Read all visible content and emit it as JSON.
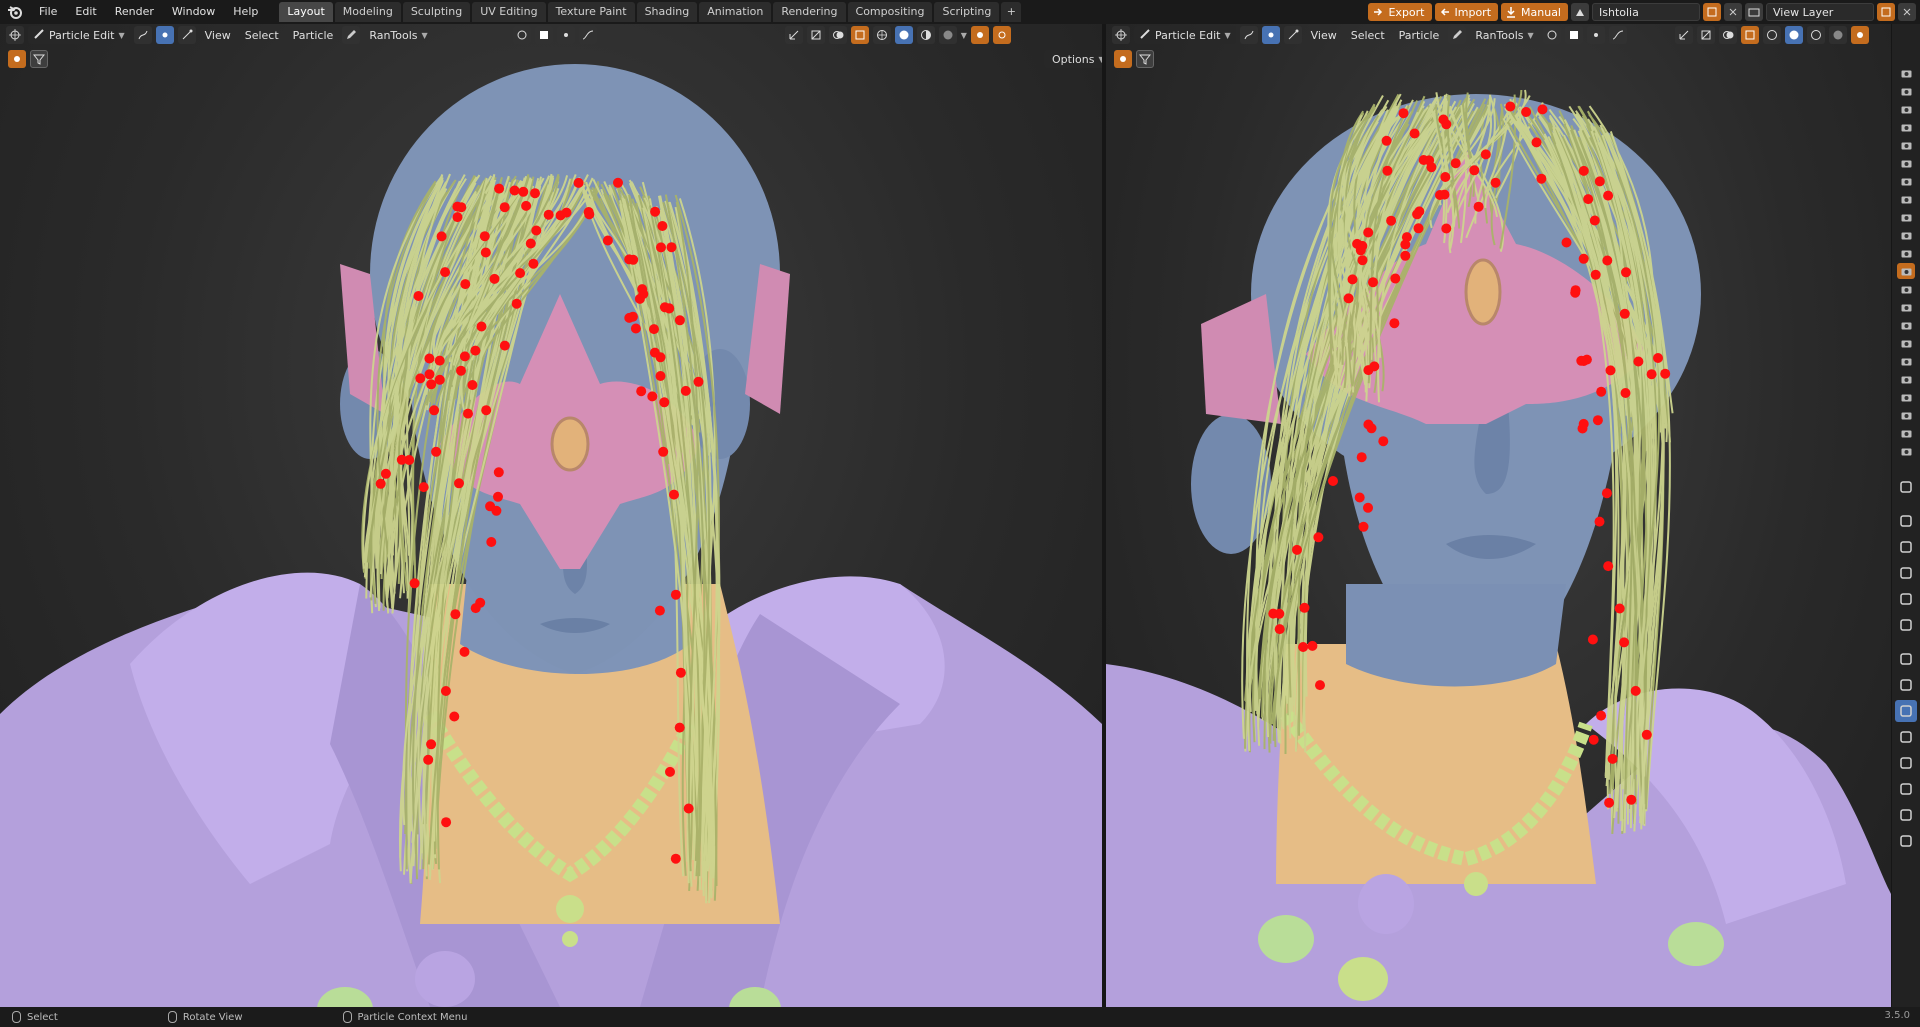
{
  "menu": [
    "File",
    "Edit",
    "Render",
    "Window",
    "Help"
  ],
  "workspace_tabs": [
    {
      "label": "Layout",
      "active": true
    },
    {
      "label": "Modeling"
    },
    {
      "label": "Sculpting"
    },
    {
      "label": "UV Editing"
    },
    {
      "label": "Texture Paint"
    },
    {
      "label": "Shading"
    },
    {
      "label": "Animation"
    },
    {
      "label": "Rendering"
    },
    {
      "label": "Compositing"
    },
    {
      "label": "Scripting"
    }
  ],
  "tab_add": "+",
  "top_right": {
    "export_label": "Export",
    "import_label": "Import",
    "manual_label": "Manual",
    "scene_name": "Ishtolia",
    "view_layer": "View Layer"
  },
  "viewport": {
    "mode": "Particle Edit",
    "menus": [
      "View",
      "Select",
      "Particle"
    ],
    "addon": "RanTools",
    "options": "Options"
  },
  "status": {
    "select": "Select",
    "rotate": "Rotate View",
    "context": "Particle Context Menu",
    "version": "3.5.0"
  },
  "colors": {
    "accent_orange": "#c46c1e",
    "accent_blue": "#4772b3",
    "skin": "#7e93b5",
    "tiara": "#d58fb6",
    "hair": "#c8cf86",
    "cloak": "#b7a2df",
    "collar": "#e8c089",
    "particle_points": "#ff1010"
  }
}
